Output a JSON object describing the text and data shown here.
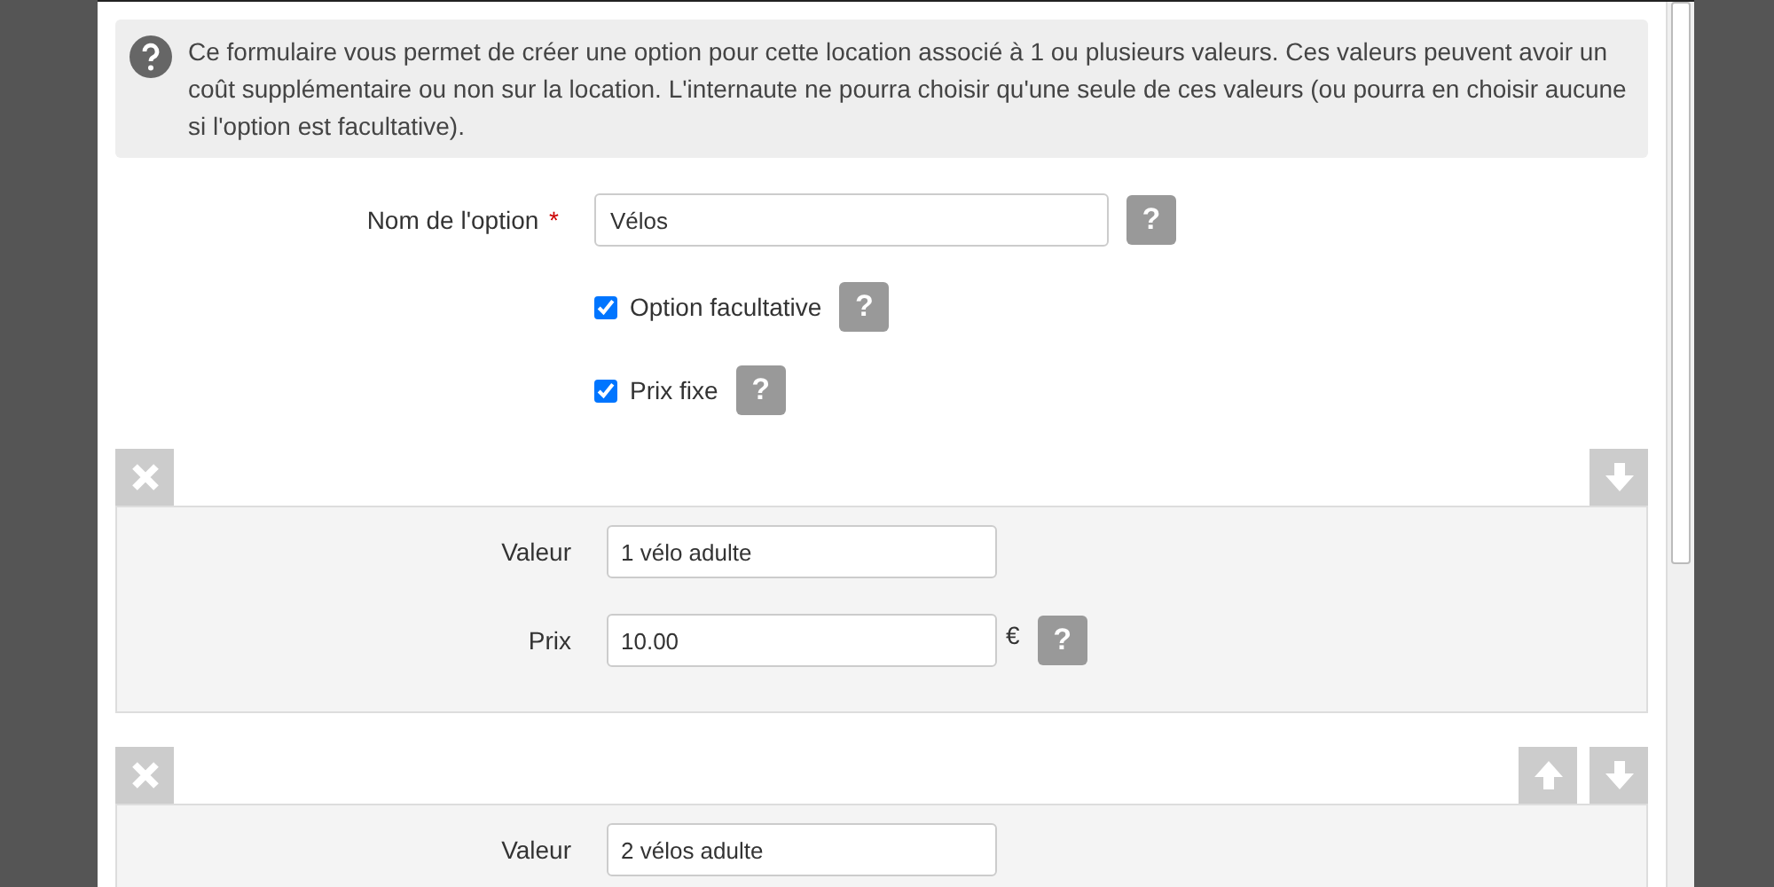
{
  "help_text": "Ce formulaire vous permet de créer une option pour cette location associé à 1 ou plusieurs valeurs. Ces valeurs peuvent avoir un coût supplémentaire ou non sur la location. L'internaute ne pourra choisir qu'une seule de ces valeurs (ou pourra en choisir aucune si l'option est facultative).",
  "name_field": {
    "label": "Nom de l'option",
    "required_mark": "*",
    "value": "Vélos",
    "help": "?"
  },
  "checkboxes": [
    {
      "label": "Option facultative",
      "checked": true,
      "help": "?"
    },
    {
      "label": "Prix fixe",
      "checked": true,
      "help": "?"
    }
  ],
  "values": [
    {
      "can_move_up": false,
      "can_move_down": true,
      "value_label": "Valeur",
      "value": "1 vélo adulte",
      "price_label": "Prix",
      "price": "10.00",
      "currency": "€",
      "help": "?"
    },
    {
      "can_move_up": true,
      "can_move_down": true,
      "value_label": "Valeur",
      "value": "2 vélos adulte"
    }
  ]
}
